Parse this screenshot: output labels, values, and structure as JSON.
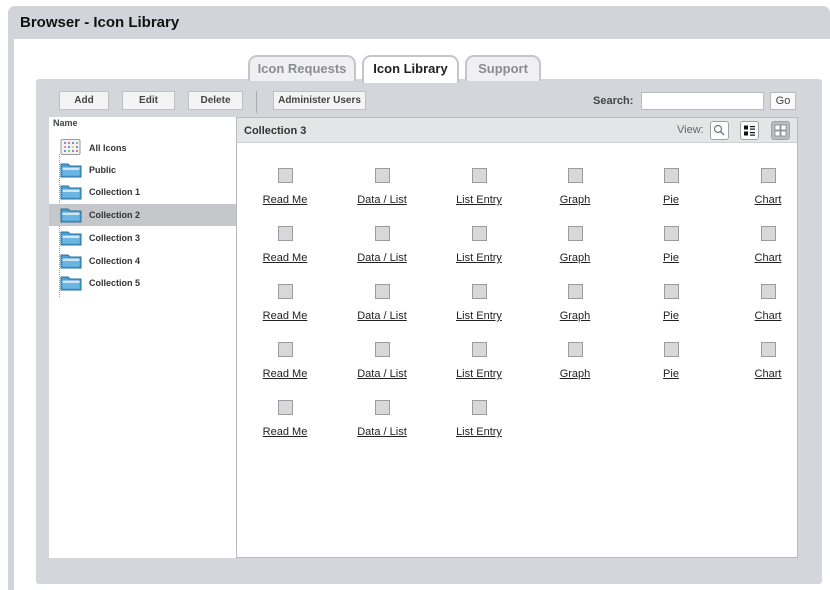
{
  "window": {
    "title": "Browser - Icon Library"
  },
  "tabs": [
    {
      "label": "Icon Requests",
      "active": false
    },
    {
      "label": "Icon Library",
      "active": true
    },
    {
      "label": "Support",
      "active": false
    }
  ],
  "toolbar": {
    "add": "Add",
    "edit": "Edit",
    "delete": "Delete",
    "administer_users": "Administer Users",
    "search_label": "Search:",
    "search_value": "",
    "go": "Go"
  },
  "sidebar": {
    "header": "Name",
    "items": [
      {
        "label": "All Icons",
        "icon": "all-icons-icon"
      },
      {
        "label": "Public",
        "icon": "folder-icon"
      },
      {
        "label": "Collection 1",
        "icon": "folder-icon"
      },
      {
        "label": "Collection 2",
        "icon": "folder-icon",
        "selected": true
      },
      {
        "label": "Collection 3",
        "icon": "folder-icon"
      },
      {
        "label": "Collection 4",
        "icon": "folder-icon"
      },
      {
        "label": "Collection 5",
        "icon": "folder-icon"
      }
    ]
  },
  "main": {
    "title": "Collection 3",
    "view_label": "View:",
    "view_modes": [
      "search-view-icon",
      "list-view-icon",
      "grid-view-icon"
    ],
    "active_view": "grid-view-icon",
    "rows": [
      [
        "Read Me",
        "Data / List",
        "List Entry",
        "Graph",
        "Pie",
        "Chart"
      ],
      [
        "Read Me",
        "Data / List",
        "List Entry",
        "Graph",
        "Pie",
        "Chart"
      ],
      [
        "Read Me",
        "Data / List",
        "List Entry",
        "Graph",
        "Pie",
        "Chart"
      ],
      [
        "Read Me",
        "Data / List",
        "List Entry",
        "Graph",
        "Pie",
        "Chart"
      ],
      [
        "Read Me",
        "Data / List",
        "List Entry"
      ]
    ]
  },
  "colors": {
    "frame": "#d2d4d9",
    "selected_row": "#c6c7ca",
    "folder_blue": "#4a9fd6"
  }
}
